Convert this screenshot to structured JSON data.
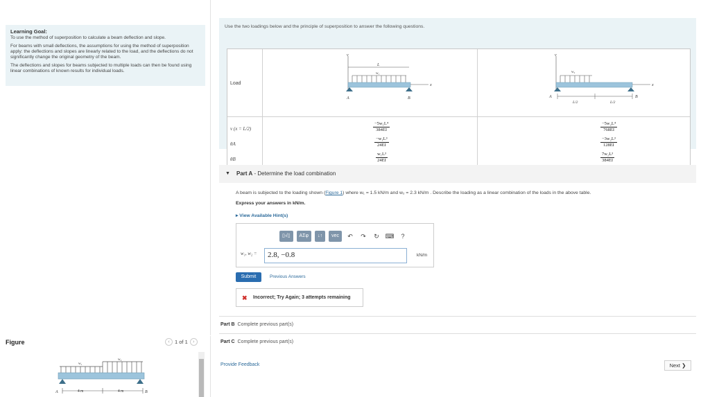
{
  "learning_goal": {
    "heading": "Learning Goal:",
    "line1": "To use the method of superposition to calculate a beam deflection and slope.",
    "para2": "For beams with small deflections, the assumptions for using the method of superposition apply: the deflections and slopes are linearly related to the load, and the deflections do not significantly change the original geometry of the beam.",
    "para3": "The deflections and slopes for beams subjected to multiple loads can then be found using linear combinations of known results for individual loads."
  },
  "figure": {
    "title": "Figure",
    "pager": "1 of 1",
    "prev_icon": "chevron-left-icon",
    "next_icon": "chevron-right-icon",
    "w1_label": "w₁",
    "w2_label": "w₂",
    "seg1": "4 m",
    "seg2": "4 m",
    "a_label": "A",
    "b_label": "B"
  },
  "table": {
    "intro": "Use the two loadings below and the principle of superposition to answer the following questions.",
    "row_load": "Load",
    "row_v_prefix": "v",
    "row_theta_a": "θA",
    "row_theta_b": "θB",
    "col1": {
      "v_label": "v",
      "l_label": "L",
      "w_label": "w₁",
      "x_label": "x",
      "a_label": "A",
      "b_label": "B",
      "v_num": "−5w₁L⁴",
      "v_den": "384EI",
      "ta_num": "−w₁L³",
      "ta_den": "24EI",
      "tb_num": "w₁L³",
      "tb_den": "24EI"
    },
    "col2": {
      "v_label": "v",
      "w_label": "w₂",
      "x_label": "x",
      "a_label": "A",
      "b_label": "B",
      "half1": "L/2",
      "half2": "L/2",
      "v_num": "−5w₂L⁴",
      "v_den": "768EI",
      "ta_num": "−3w₂L³",
      "ta_den": "128EI",
      "tb_num": "7w₂L³",
      "tb_den": "384EI"
    },
    "v_cond": "(x = L/2)"
  },
  "part_a": {
    "label": "Part A",
    "title": " - Determine the load combination",
    "question_pre": "A beam is subjected to the loading shown (",
    "figure_link": "Figure 1",
    "question_post": ") where w₁ = 1.5 kN/m and w₂ = 2.3 kN/m . Describe the loading as a linear combination of the loads in the above table.",
    "express": "Express your answers in kN/m.",
    "hints": "▸ View Available Hint(s)",
    "toolbar": {
      "templates": "▯√▯",
      "symbols": "ΑΣφ",
      "arrows": "↓↑",
      "vec": "vec",
      "undo_icon": "undo-icon",
      "redo_icon": "redo-icon",
      "reset_icon": "reset-icon",
      "keyboard_icon": "keyboard-icon",
      "help": "?"
    },
    "answer_label": "w₁, w₂ =",
    "answer_value": "2.8, −0.8",
    "unit": "kN/m",
    "submit": "Submit",
    "previous_answers": "Previous Answers",
    "feedback": "Incorrect; Try Again; 3 attempts remaining",
    "feedback_icon": "x-icon"
  },
  "part_b": {
    "label": "Part B",
    "status": "Complete previous part(s)"
  },
  "part_c": {
    "label": "Part C",
    "status": "Complete previous part(s)"
  },
  "footer": {
    "provide_feedback": "Provide Feedback",
    "next": "Next ❯"
  },
  "colors": {
    "beam": "#9cc4dc",
    "support": "#3d6f8a",
    "accent": "#2a6db0",
    "panel": "#eaf3f6",
    "error": "#d0312d"
  }
}
